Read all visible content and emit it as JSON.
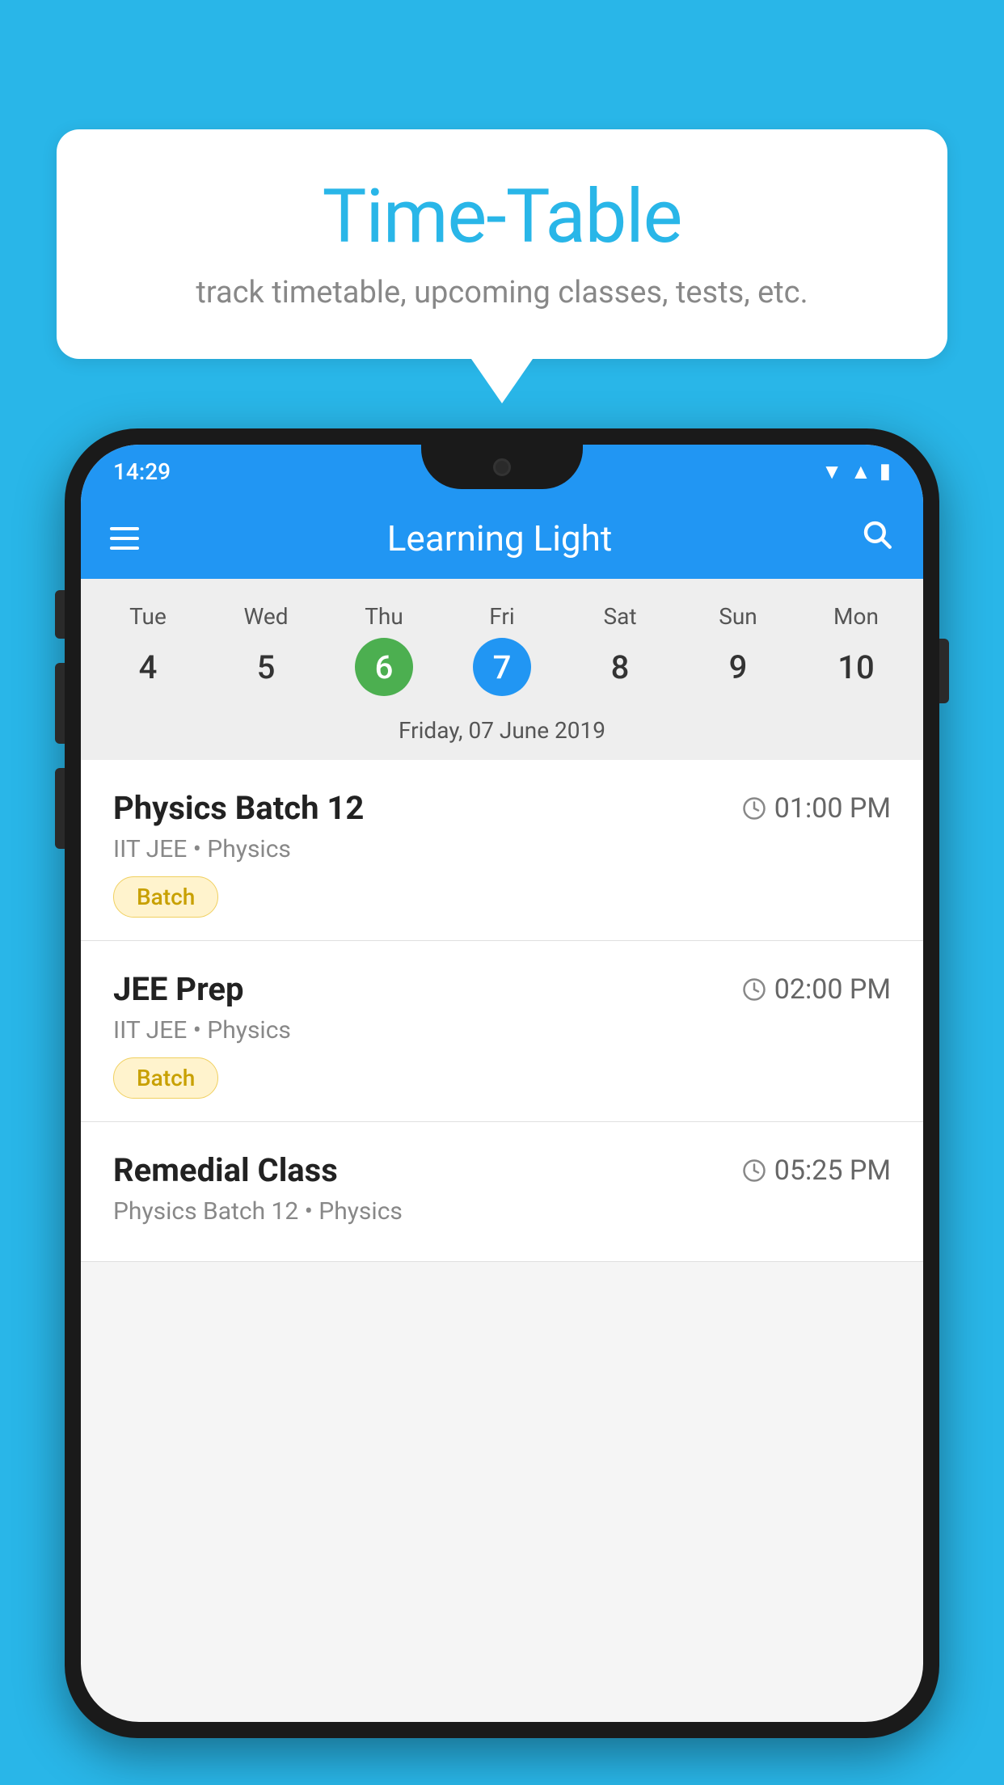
{
  "background_color": "#29b6e8",
  "bubble": {
    "title": "Time-Table",
    "subtitle": "track timetable, upcoming classes, tests, etc."
  },
  "phone": {
    "status_bar": {
      "time": "14:29"
    },
    "toolbar": {
      "title": "Learning Light"
    },
    "calendar": {
      "days": [
        {
          "name": "Tue",
          "number": "4",
          "state": "normal"
        },
        {
          "name": "Wed",
          "number": "5",
          "state": "normal"
        },
        {
          "name": "Thu",
          "number": "6",
          "state": "today"
        },
        {
          "name": "Fri",
          "number": "7",
          "state": "selected"
        },
        {
          "name": "Sat",
          "number": "8",
          "state": "normal"
        },
        {
          "name": "Sun",
          "number": "9",
          "state": "normal"
        },
        {
          "name": "Mon",
          "number": "10",
          "state": "normal"
        }
      ],
      "selected_date_label": "Friday, 07 June 2019"
    },
    "schedule": [
      {
        "title": "Physics Batch 12",
        "time": "01:00 PM",
        "subtitle": "IIT JEE • Physics",
        "badge": "Batch"
      },
      {
        "title": "JEE Prep",
        "time": "02:00 PM",
        "subtitle": "IIT JEE • Physics",
        "badge": "Batch"
      },
      {
        "title": "Remedial Class",
        "time": "05:25 PM",
        "subtitle": "Physics Batch 12 • Physics",
        "badge": null
      }
    ]
  }
}
